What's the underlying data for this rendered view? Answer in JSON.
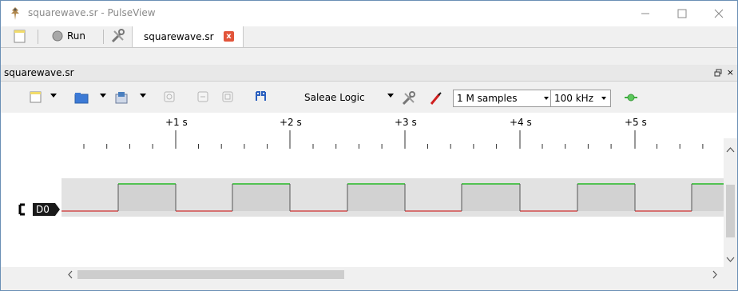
{
  "window": {
    "title": "squarewave.sr - PulseView"
  },
  "tabbar": {
    "run_label": "Run",
    "tab_label": "squarewave.sr",
    "tab_close": "x"
  },
  "dock": {
    "title": "squarewave.sr",
    "buttons": "×"
  },
  "toolbar": {
    "device": "Saleae Logic",
    "samples": "1 M samples",
    "rate": "100 kHz"
  },
  "ruler": {
    "labels": [
      "+1 s",
      "+2 s",
      "+3 s",
      "+4 s",
      "+5 s"
    ]
  },
  "channel": {
    "name": "D0"
  },
  "colors": {
    "high": "#00b400",
    "low": "#d03030",
    "signal_bg": "#e2e2e2",
    "trace_bg": "#f0f0f0"
  }
}
